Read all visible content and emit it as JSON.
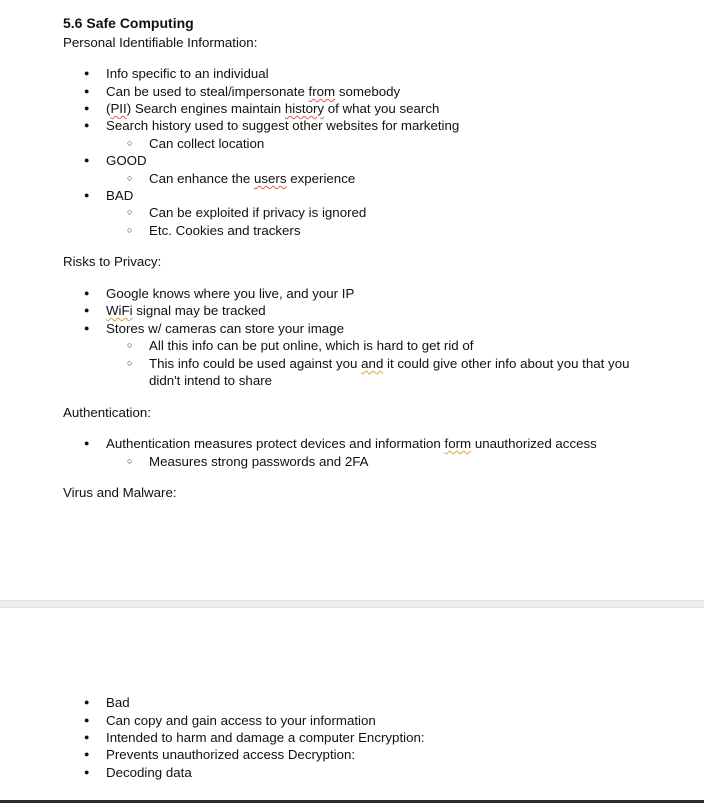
{
  "doc": {
    "title": "5.6 Safe Computing",
    "pii_heading": "Personal Identifiable Information:",
    "pii": {
      "b1": "Info specific to an individual",
      "b2a": "Can be used to steal/impersonate ",
      "b2b": "from",
      "b2c": " somebody",
      "b3a": "(",
      "b3b": "PII",
      "b3c": ") Search engines maintain ",
      "b3d": "history",
      "b3e": " of what you search",
      "b4": "Search history used to suggest other websites for marketing",
      "b4s1": "Can collect location",
      "b5": "GOOD",
      "b5s1a": "Can enhance the ",
      "b5s1b": "users",
      "b5s1c": " experience",
      "b6": "BAD",
      "b6s1": "Can be exploited if privacy is ignored",
      "b6s2": "Etc. Cookies and trackers"
    },
    "risks_heading": "Risks to Privacy:",
    "risks": {
      "b1": "Google knows where you live, and your IP",
      "b2a": "WiFi",
      "b2b": " signal may be tracked",
      "b3": "Stores w/ cameras can store your image",
      "b3s1": "All this info can be put online, which is hard to get rid of",
      "b3s2a": "This info could be used against you ",
      "b3s2b": "and",
      "b3s2c": " it could give other info about you that you",
      "b3s2d": "didn't intend to share"
    },
    "auth_heading": "Authentication:",
    "auth": {
      "b1a": "Authentication measures protect devices and information ",
      "b1b": "form",
      "b1c": " unauthorized access",
      "b1s1": "Measures strong passwords and 2FA"
    },
    "virus_heading": "Virus and Malware:",
    "virus": {
      "b1": "Bad",
      "b2": "Can copy and gain access to your information",
      "b3": "Intended to harm and damage a computer Encryption:",
      "b4": "Prevents unauthorized access Decryption:",
      "b5": "Decoding data"
    }
  }
}
